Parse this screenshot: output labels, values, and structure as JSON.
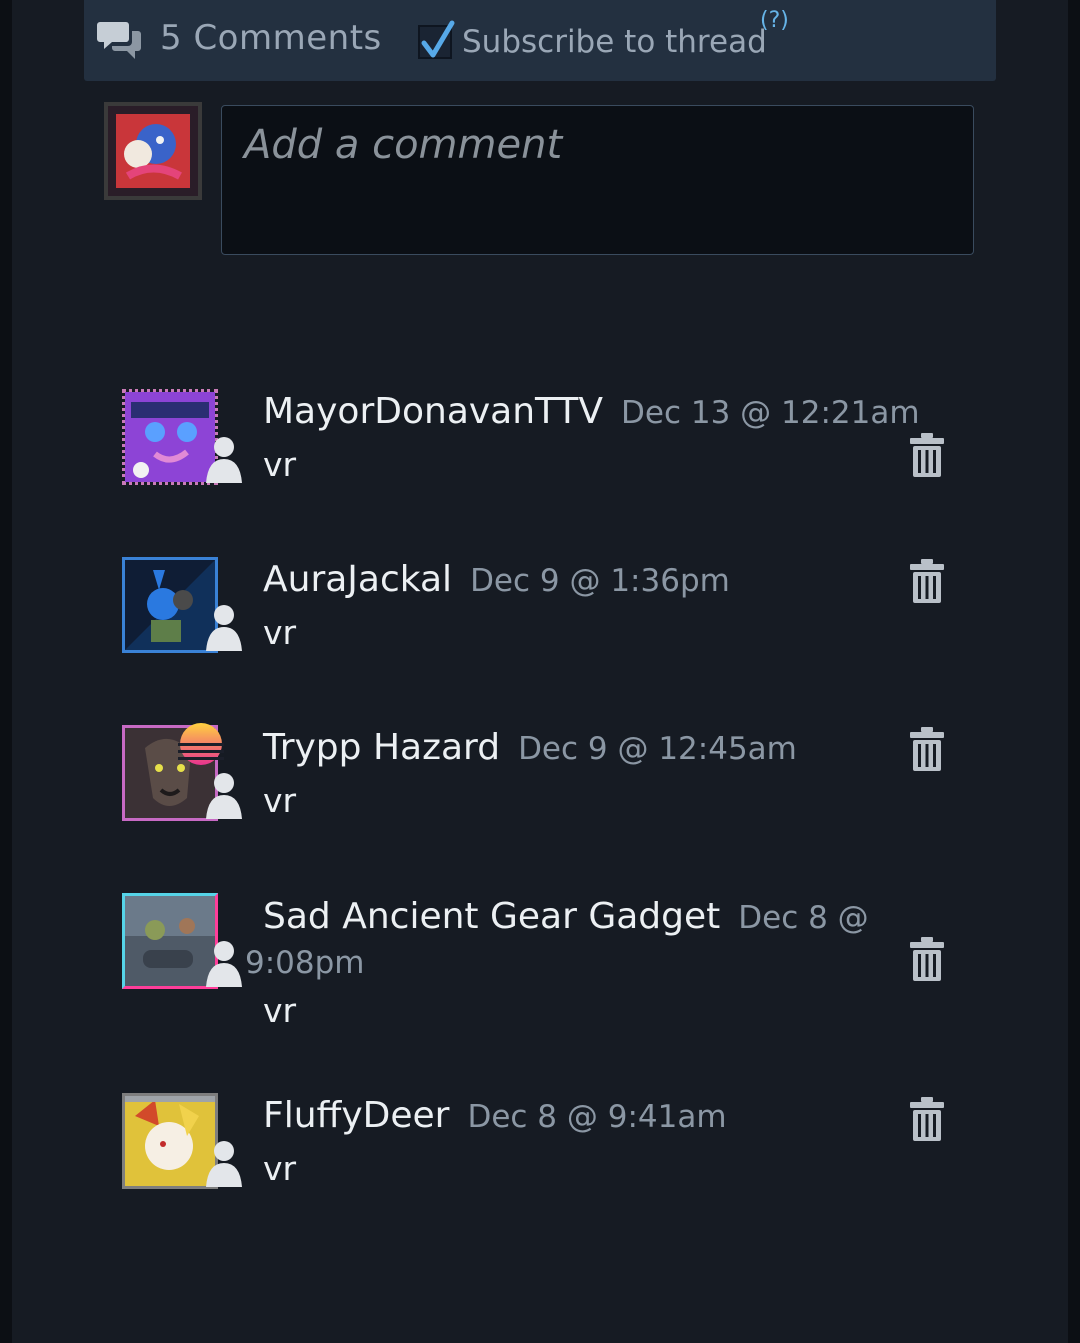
{
  "header": {
    "comment_count": "5 Comments",
    "subscribe_label": "Subscribe to thread",
    "subscribe_checked": true,
    "help_label": "(?)"
  },
  "comment_box": {
    "placeholder": "Add a comment"
  },
  "colors": {
    "panel_bg": "#161b23",
    "header_bg": "#233040",
    "accent_blue": "#66b4e8",
    "muted_text": "#8b97a4"
  },
  "comments": [
    {
      "author": "MayorDonavanTTV",
      "timestamp": "Dec 13 @ 12:21am",
      "text": "vr",
      "delete_icon": "trash-icon"
    },
    {
      "author": "AuraJackal",
      "timestamp": "Dec 9 @ 1:36pm",
      "text": "vr",
      "delete_icon": "trash-icon"
    },
    {
      "author": "Trypp Hazard",
      "timestamp": "Dec 9 @ 12:45am",
      "text": "vr",
      "delete_icon": "trash-icon"
    },
    {
      "author": "Sad Ancient Gear Gadget",
      "timestamp_line1": "Dec 8 @",
      "timestamp_line2": "9:08pm",
      "text": "vr",
      "delete_icon": "trash-icon"
    },
    {
      "author": "FluffyDeer",
      "timestamp": "Dec 8 @ 9:41am",
      "text": "vr",
      "delete_icon": "trash-icon"
    }
  ]
}
